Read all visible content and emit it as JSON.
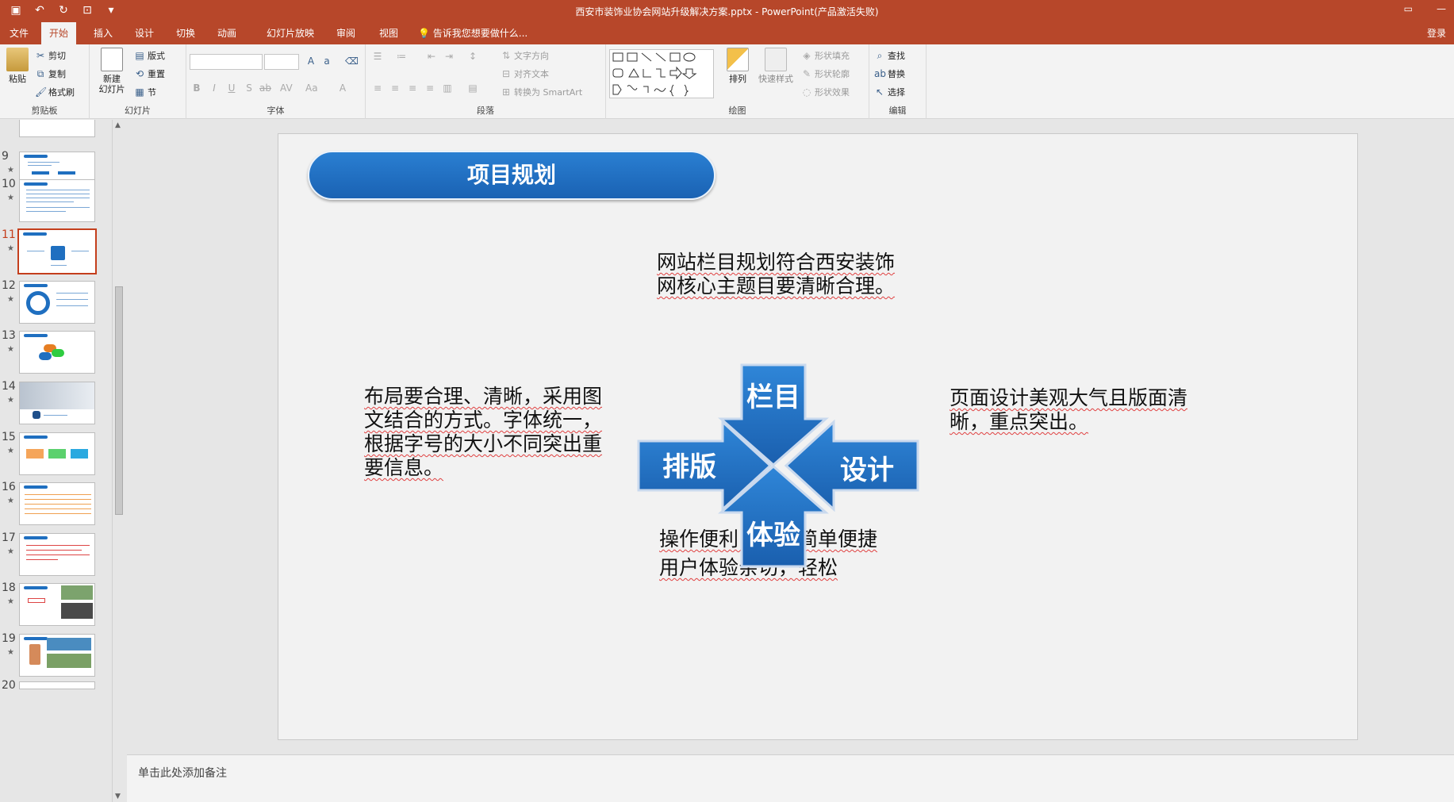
{
  "window": {
    "title": "西安市装饰业协会网站升级解决方案.pptx - PowerPoint(产品激活失败)"
  },
  "tabs": [
    {
      "label": "文件",
      "active": false
    },
    {
      "label": "开始",
      "active": true
    },
    {
      "label": "插入",
      "active": false
    },
    {
      "label": "设计",
      "active": false
    },
    {
      "label": "切换",
      "active": false
    },
    {
      "label": "动画",
      "active": false
    },
    {
      "label": "幻灯片放映",
      "active": false
    },
    {
      "label": "审阅",
      "active": false
    },
    {
      "label": "视图",
      "active": false
    }
  ],
  "tell_me": "告诉我您想要做什么...",
  "login": "登录",
  "ribbon": {
    "clipboard": {
      "paste": "粘贴",
      "cut": "剪切",
      "copy": "复制",
      "format_painter": "格式刷",
      "label": "剪贴板"
    },
    "slides": {
      "new_slide": "新建\n幻灯片",
      "layout": "版式",
      "reset": "重置",
      "section": "节",
      "label": "幻灯片"
    },
    "font": {
      "label": "字体"
    },
    "paragraph": {
      "text_direction": "文字方向",
      "align_text": "对齐文本",
      "smartart": "转换为 SmartArt",
      "label": "段落"
    },
    "drawing": {
      "arrange": "排列",
      "quick_styles": "快速样式",
      "shape_fill": "形状填充",
      "shape_outline": "形状轮廓",
      "shape_effects": "形状效果",
      "label": "绘图"
    },
    "editing": {
      "find": "查找",
      "replace": "替换",
      "select": "选择",
      "label": "编辑"
    }
  },
  "thumbnails": [
    {
      "num": "9",
      "active": false
    },
    {
      "num": "10",
      "active": false
    },
    {
      "num": "11",
      "active": true
    },
    {
      "num": "12",
      "active": false
    },
    {
      "num": "13",
      "active": false
    },
    {
      "num": "14",
      "active": false
    },
    {
      "num": "15",
      "active": false
    },
    {
      "num": "16",
      "active": false
    },
    {
      "num": "17",
      "active": false
    },
    {
      "num": "18",
      "active": false
    },
    {
      "num": "19",
      "active": false
    },
    {
      "num": "20",
      "active": false
    }
  ],
  "slide": {
    "title": "项目规划",
    "text_top": "网站栏目规划符合西安装饰\n网核心主题目要清晰合理。",
    "text_left": "布局要合理、清晰，采用图\n文结合的方式。字体统一，\n根据字号的大小不同突出重\n要信息。",
    "text_right": "页面设计美观大气且版面清\n晰，重点突出。",
    "text_bottom": "操作便利，维护简单便捷\n用户体验亲切，轻松",
    "arrows": {
      "top": "栏目",
      "left": "排版",
      "right": "设计",
      "bottom": "体验"
    },
    "arrow_color": "#1f6fc0"
  },
  "notes_placeholder": "单击此处添加备注",
  "colors": {
    "accent": "#b7472a",
    "slide_blue": "#1f6fc0"
  }
}
